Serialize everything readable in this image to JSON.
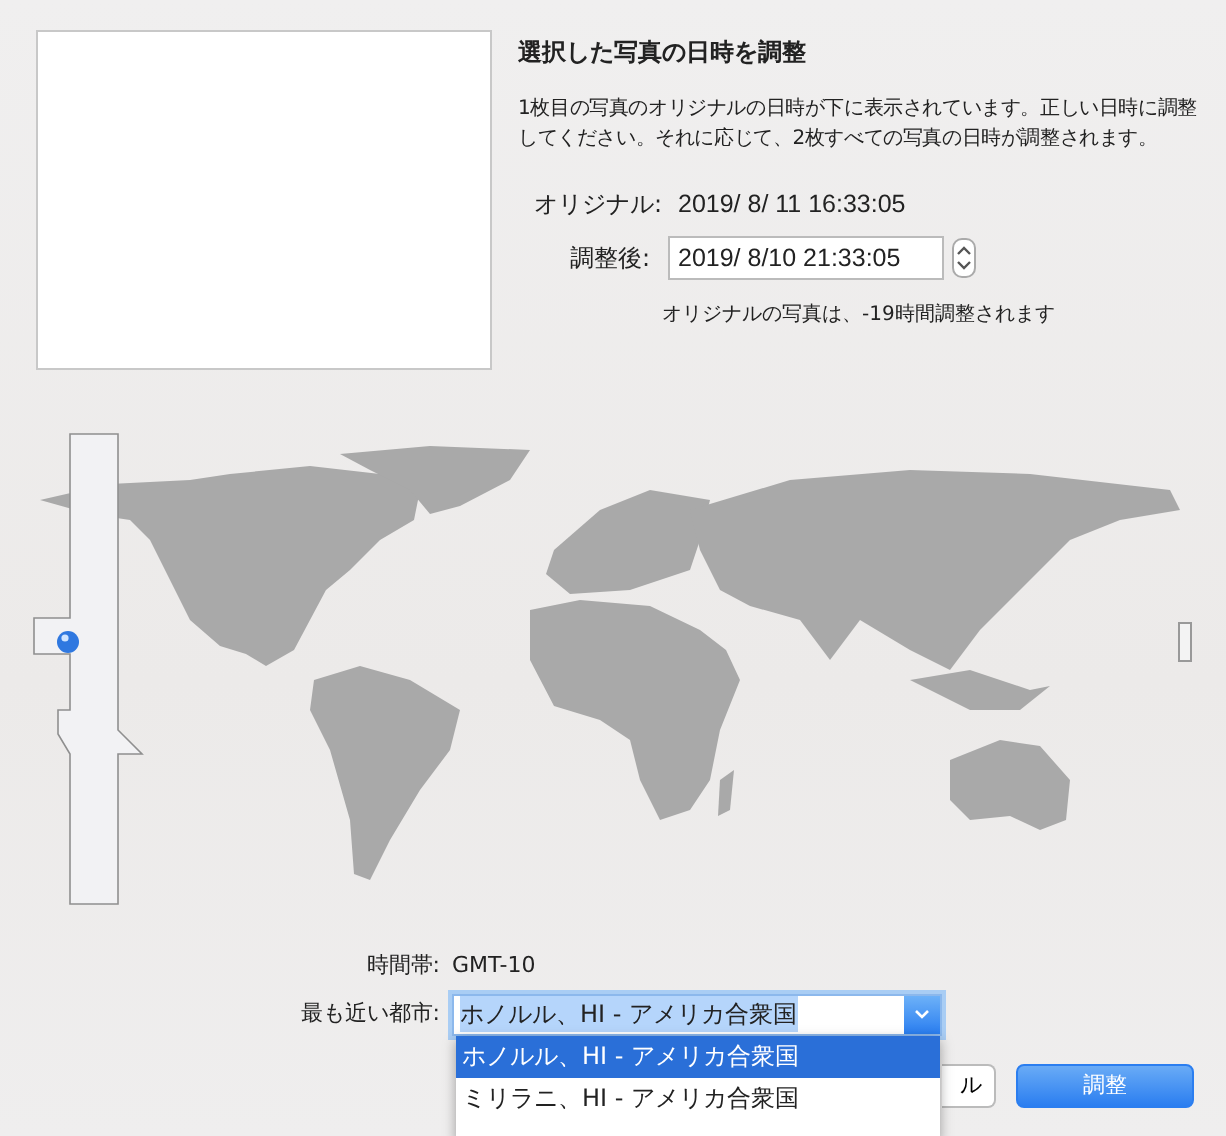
{
  "title": "選択した写真の日時を調整",
  "description": "1枚目の写真のオリジナルの日時が下に表示されています。正しい日時に調整してください。それに応じて、2枚すべての写真の日時が調整されます。",
  "original": {
    "label": "オリジナル:",
    "value": "2019/ 8/ 11 16:33:05"
  },
  "adjusted": {
    "label": "調整後:",
    "value": "2019/ 8/10 21:33:05"
  },
  "note": "オリジナルの写真は、-19時間調整されます",
  "time_zone": {
    "label": "時間帯:",
    "value": "GMT-10"
  },
  "nearest_city": {
    "label": "最も近い都市:",
    "value": "ホノルル、HI - アメリカ合衆国"
  },
  "city_options": [
    {
      "label": "ホノルル、HI - アメリカ合衆国",
      "selected": true
    },
    {
      "label": "ミリラニ、HI - アメリカ合衆国",
      "selected": false
    }
  ],
  "buttons": [
    {
      "label": "ル",
      "kind": "cancel"
    },
    {
      "label": "調整",
      "kind": "primary"
    }
  ]
}
